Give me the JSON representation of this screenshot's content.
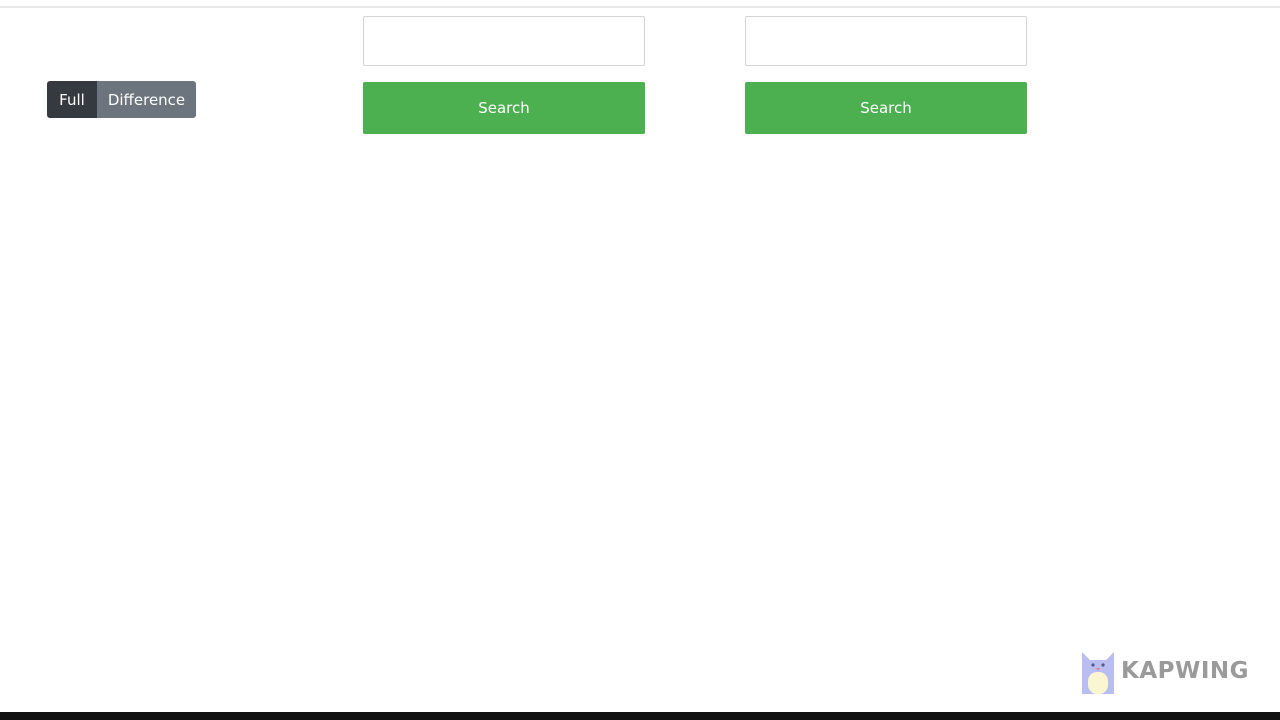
{
  "view_toggle": {
    "full_label": "Full",
    "difference_label": "Difference"
  },
  "left_panel": {
    "input_value": "",
    "search_label": "Search"
  },
  "right_panel": {
    "input_value": "",
    "search_label": "Search"
  },
  "watermark": {
    "text": "KAPWING"
  },
  "colors": {
    "search_green": "#4caf50",
    "toggle_active": "#343a40",
    "toggle_inactive": "#6c757d"
  }
}
